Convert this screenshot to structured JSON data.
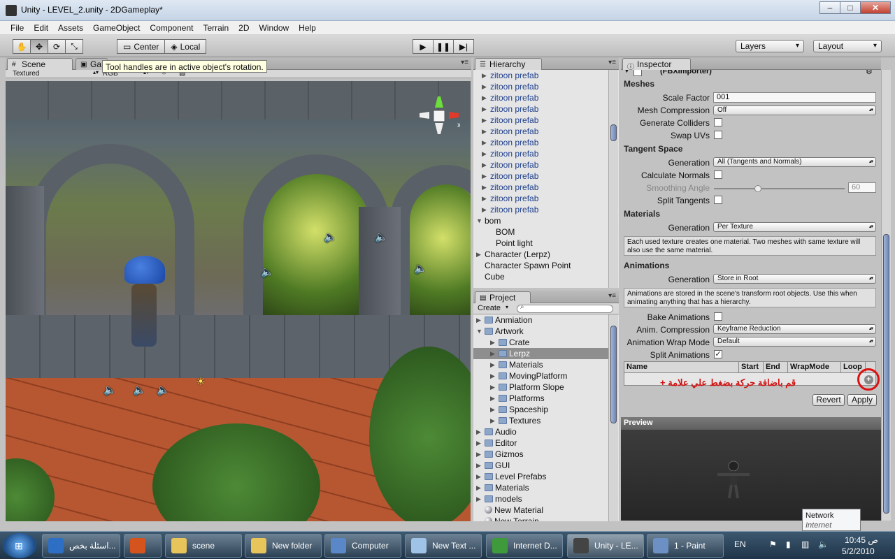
{
  "window": {
    "title": "Unity - LEVEL_2.unity - 2DGameplay*"
  },
  "menu": [
    "File",
    "Edit",
    "Assets",
    "GameObject",
    "Component",
    "Terrain",
    "2D",
    "Window",
    "Help"
  ],
  "toolbar": {
    "pivot_label": "Center",
    "space_label": "Local",
    "layers_label": "Layers",
    "layout_label": "Layout"
  },
  "scene": {
    "tab_scene": "Scene",
    "tab_game": "Ga",
    "render_mode": "Textured",
    "color_mode": "RGB",
    "tooltip": "Tool handles are in active object's rotation.",
    "gizmo_axis": "x"
  },
  "hierarchy": {
    "tab": "Hierarchy",
    "items": [
      {
        "label": "zitoon prefab",
        "prefab": true,
        "indent": 1
      },
      {
        "label": "zitoon prefab",
        "prefab": true,
        "indent": 1
      },
      {
        "label": "zitoon prefab",
        "prefab": true,
        "indent": 1
      },
      {
        "label": "zitoon prefab",
        "prefab": true,
        "indent": 1
      },
      {
        "label": "zitoon prefab",
        "prefab": true,
        "indent": 1
      },
      {
        "label": "zitoon prefab",
        "prefab": true,
        "indent": 1
      },
      {
        "label": "zitoon prefab",
        "prefab": true,
        "indent": 1
      },
      {
        "label": "zitoon prefab",
        "prefab": true,
        "indent": 1
      },
      {
        "label": "zitoon prefab",
        "prefab": true,
        "indent": 1
      },
      {
        "label": "zitoon prefab",
        "prefab": true,
        "indent": 1
      },
      {
        "label": "zitoon prefab",
        "prefab": true,
        "indent": 1
      },
      {
        "label": "zitoon prefab",
        "prefab": true,
        "indent": 1
      },
      {
        "label": "zitoon prefab",
        "prefab": true,
        "indent": 1
      },
      {
        "label": "bom",
        "prefab": false,
        "indent": 0,
        "expanded": true
      },
      {
        "label": "BOM",
        "prefab": false,
        "indent": 2
      },
      {
        "label": "Point light",
        "prefab": false,
        "indent": 2
      },
      {
        "label": "Character (Lerpz)",
        "prefab": false,
        "indent": 0,
        "collapsed": true
      },
      {
        "label": "Character Spawn Point",
        "prefab": false,
        "indent": 0
      },
      {
        "label": "Cube",
        "prefab": false,
        "indent": 0
      }
    ]
  },
  "project": {
    "tab": "Project",
    "create_label": "Create",
    "items": [
      {
        "label": "Anmiation",
        "indent": 0
      },
      {
        "label": "Artwork",
        "indent": 0,
        "expanded": true
      },
      {
        "label": "Crate",
        "indent": 1
      },
      {
        "label": "Lerpz",
        "indent": 1,
        "selected": true
      },
      {
        "label": "Materials",
        "indent": 1
      },
      {
        "label": "MovingPlatform",
        "indent": 1
      },
      {
        "label": "Platform Slope",
        "indent": 1
      },
      {
        "label": "Platforms",
        "indent": 1
      },
      {
        "label": "Spaceship",
        "indent": 1
      },
      {
        "label": "Textures",
        "indent": 1
      },
      {
        "label": "Audio",
        "indent": 0
      },
      {
        "label": "Editor",
        "indent": 0
      },
      {
        "label": "Gizmos",
        "indent": 0
      },
      {
        "label": "GUI",
        "indent": 0
      },
      {
        "label": "Level Prefabs",
        "indent": 0
      },
      {
        "label": "Materials",
        "indent": 0
      },
      {
        "label": "models",
        "indent": 0
      },
      {
        "label": "New Material",
        "indent": 0,
        "material": true
      },
      {
        "label": "New Terrain",
        "indent": 0,
        "material": true
      }
    ]
  },
  "inspector": {
    "tab": "Inspector",
    "component": "(FBXImporter)",
    "meshes_header": "Meshes",
    "scale_factor_label": "Scale Factor",
    "scale_factor_value": "001",
    "mesh_compression_label": "Mesh Compression",
    "mesh_compression_value": "Off",
    "generate_colliders_label": "Generate Colliders",
    "swap_uvs_label": "Swap UVs",
    "tangent_header": "Tangent Space",
    "tangent_generation_label": "Generation",
    "tangent_generation_value": "All (Tangents and Normals)",
    "calc_normals_label": "Calculate Normals",
    "smoothing_label": "Smoothing Angle",
    "smoothing_value": "60",
    "split_tangents_label": "Split Tangents",
    "materials_header": "Materials",
    "materials_generation_label": "Generation",
    "materials_generation_value": "Per Texture",
    "materials_info": "Each used texture creates one material. Two meshes with same texture will also use the same material.",
    "animations_header": "Animations",
    "anim_generation_label": "Generation",
    "anim_generation_value": "Store in Root",
    "anim_info": "Animations are stored in the scene's transform root objects. Use this when animating anything that has a hierarchy.",
    "bake_label": "Bake Animations",
    "anim_compression_label": "Anim. Compression",
    "anim_compression_value": "Keyframe Reduction",
    "wrap_mode_label": "Animation Wrap Mode",
    "wrap_mode_value": "Default",
    "split_label": "Split Animations",
    "split_checked": "✓",
    "table_cols": [
      "Name",
      "Start",
      "End",
      "WrapMode",
      "Loop"
    ],
    "arabic_note": "قم باضافة حركة  بضغط علي علامة +",
    "add_symbol": "+",
    "revert_label": "Revert",
    "apply_label": "Apply",
    "preview_label": "Preview"
  },
  "taskbar": {
    "items": [
      {
        "label": "اسئلة بخص...",
        "color": "#2d6fc4"
      },
      {
        "label": "",
        "color": "#d5541d"
      },
      {
        "label": "scene",
        "color": "#e7c55a"
      },
      {
        "label": "New folder",
        "color": "#e7c55a"
      },
      {
        "label": "Computer",
        "color": "#5987c7"
      },
      {
        "label": "New Text ...",
        "color": "#9fc3e6"
      },
      {
        "label": "Internet D...",
        "color": "#3f9a3b"
      },
      {
        "label": "Unity - LE...",
        "color": "#444444"
      },
      {
        "label": "1 - Paint",
        "color": "#6c8fc4"
      }
    ],
    "lang": "EN",
    "time": "10:45 ص",
    "date": "5/2/2010",
    "network_tip_title": "Network",
    "network_tip_sub": "Internet access"
  }
}
